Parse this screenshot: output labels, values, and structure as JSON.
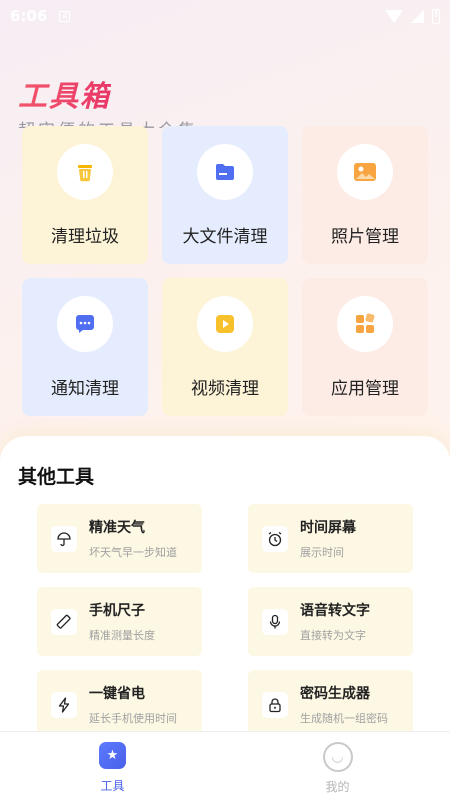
{
  "status_bar": {
    "time": "6:06"
  },
  "hero": {
    "title": "工具箱",
    "subtitle": "超实便的工具大全集"
  },
  "main_tools": [
    {
      "label": "清理垃圾",
      "icon": "trash-icon",
      "theme": "yellow"
    },
    {
      "label": "大文件清理",
      "icon": "folder-icon",
      "theme": "blue"
    },
    {
      "label": "照片管理",
      "icon": "image-icon",
      "theme": "pink"
    },
    {
      "label": "通知清理",
      "icon": "chat-bubble-icon",
      "theme": "blue"
    },
    {
      "label": "视频清理",
      "icon": "play-icon",
      "theme": "yellow"
    },
    {
      "label": "应用管理",
      "icon": "apps-grid-icon",
      "theme": "pink"
    }
  ],
  "other_tools": {
    "title": "其他工具",
    "items": [
      {
        "name": "精准天气",
        "desc": "坏天气早一步知道",
        "icon": "umbrella-icon"
      },
      {
        "name": "时间屏幕",
        "desc": "展示时间",
        "icon": "alarm-clock-icon"
      },
      {
        "name": "手机尺子",
        "desc": "精准测量长度",
        "icon": "ruler-icon"
      },
      {
        "name": "语音转文字",
        "desc": "直接转为文字",
        "icon": "microphone-icon"
      },
      {
        "name": "一键省电",
        "desc": "延长手机使用时间",
        "icon": "lightning-icon"
      },
      {
        "name": "密码生成器",
        "desc": "生成随机一组密码",
        "icon": "lock-icon"
      }
    ]
  },
  "bottom_nav": [
    {
      "label": "工具",
      "icon": "toolbox-star-icon",
      "active": true
    },
    {
      "label": "我的",
      "icon": "smiley-face-icon",
      "active": false
    }
  ],
  "colors": {
    "accent": "#4a5fe8",
    "title_red": "#ec3c5c",
    "icon_orange": "#f5a23a",
    "icon_blue": "#4f6ff0"
  }
}
